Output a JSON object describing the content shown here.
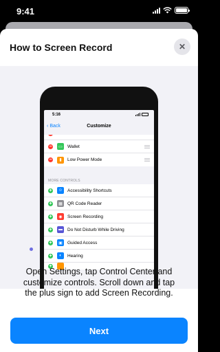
{
  "status_bar": {
    "time": "9:41"
  },
  "sheet": {
    "title": "How to Screen Record",
    "close_icon": "close-icon"
  },
  "illustration": {
    "phone": {
      "status_time": "5:16",
      "nav_back_label": "Back",
      "nav_title": "Customize",
      "included_controls": [
        {
          "label": "Wallet",
          "icon": "wallet-icon",
          "color": "#34c759"
        },
        {
          "label": "Low Power Mode",
          "icon": "battery-icon",
          "color": "#ff9500"
        }
      ],
      "more_controls_header": "MORE CONTROLS",
      "more_controls": [
        {
          "label": "Accessibility Shortcuts",
          "icon": "accessibility-icon",
          "color": "#0a84ff"
        },
        {
          "label": "QR Code Reader",
          "icon": "qr-code-icon",
          "color": "#8e8e93"
        },
        {
          "label": "Screen Recording",
          "icon": "record-icon",
          "color": "#ff3b30"
        },
        {
          "label": "Do Not Disturb While Driving",
          "icon": "car-icon",
          "color": "#5856d6"
        },
        {
          "label": "Guided Access",
          "icon": "lock-icon",
          "color": "#0a84ff"
        },
        {
          "label": "Hearing",
          "icon": "ear-icon",
          "color": "#0a84ff"
        }
      ]
    }
  },
  "instructions": "Open Settings, tap Control Center and customize controls. Scroll down and tap the plus sign to add Screen Recording.",
  "next_button": "Next",
  "colors": {
    "accent": "#0a84ff",
    "add": "#34c759",
    "remove": "#ff3b30"
  }
}
